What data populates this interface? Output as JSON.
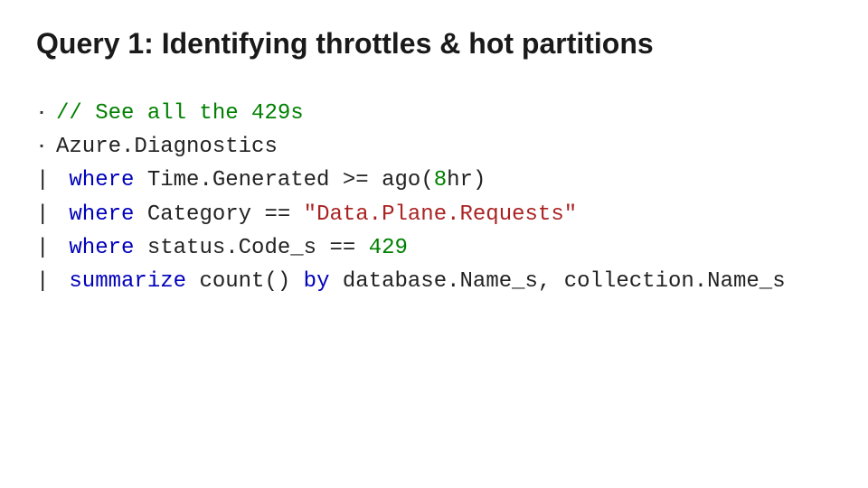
{
  "title": "Query 1: Identifying throttles & hot partitions",
  "code": {
    "line1": {
      "comment": "// See all the 429s"
    },
    "line2": {
      "table": "Azure.Diagnostics"
    },
    "line3": {
      "pipe": "|",
      "kw": "where",
      "field": "Time.Generated",
      "op": ">=",
      "fn": "ago",
      "lp": "(",
      "num": "8",
      "hr": "hr",
      "rp": ")"
    },
    "line4": {
      "pipe": "|",
      "kw": "where",
      "field": "Category",
      "op": "==",
      "str": "\"Data.Plane.Requests\""
    },
    "line5": {
      "pipe": "|",
      "kw": "where",
      "field": "status.Code_s",
      "op": "==",
      "num": "429"
    },
    "line6": {
      "pipe": "|",
      "kw": "summarize",
      "fn": "count",
      "parens": "()",
      "by": "by",
      "col1": "database.Name_s",
      "sep": ",",
      "col2": "collection.Name_s"
    }
  }
}
